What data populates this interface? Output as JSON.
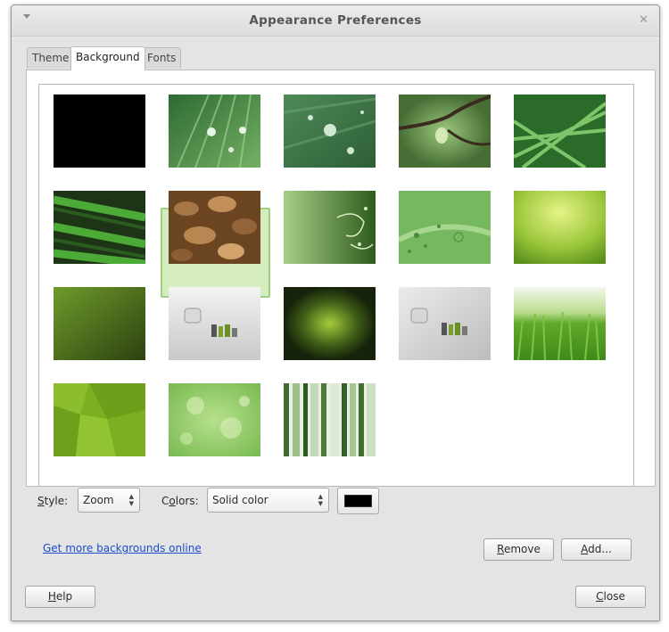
{
  "window": {
    "title": "Appearance Preferences"
  },
  "tabs": [
    {
      "label": "Theme"
    },
    {
      "label": "Background",
      "active": true
    },
    {
      "label": "Fonts"
    }
  ],
  "wallpapers": [
    {
      "name": "black-solid"
    },
    {
      "name": "green-leaf-drops"
    },
    {
      "name": "water-drops-on-leaf"
    },
    {
      "name": "branch-with-drop"
    },
    {
      "name": "green-grass-blades"
    },
    {
      "name": "fern-fronds"
    },
    {
      "name": "pebbles-in-water"
    },
    {
      "name": "green-swirl-vector"
    },
    {
      "name": "green-circles-vector"
    },
    {
      "name": "yellow-green-glow"
    },
    {
      "name": "dark-green-gradient"
    },
    {
      "name": "linux-mint-logo-grey",
      "selected": true
    },
    {
      "name": "dark-green-radial"
    },
    {
      "name": "linux-mint-logo-grey-2"
    },
    {
      "name": "green-grass-field"
    },
    {
      "name": "green-polygons"
    },
    {
      "name": "green-bokeh"
    },
    {
      "name": "green-vertical-stripes"
    }
  ],
  "style": {
    "label": "Style:",
    "mnemonic": "S",
    "rest": "tyle:",
    "value": "Zoom"
  },
  "colors": {
    "label": "Colors:",
    "mnemonic": "o",
    "prefix": "C",
    "rest": "lors:",
    "value": "Solid color",
    "swatch": "#000000"
  },
  "link": {
    "label": "Get more backgrounds online"
  },
  "buttons": {
    "remove": {
      "label": "Remove",
      "mnemonic": "R",
      "rest": "emove"
    },
    "add": {
      "label": "Add...",
      "mnemonic": "A",
      "rest": "dd..."
    },
    "help": {
      "label": "Help",
      "mnemonic": "H",
      "rest": "elp"
    },
    "close": {
      "label": "Close",
      "mnemonic": "C",
      "rest": "lose"
    }
  },
  "colors_theme": {
    "accent": "#9fcf7f",
    "link": "#1a4ccc"
  }
}
